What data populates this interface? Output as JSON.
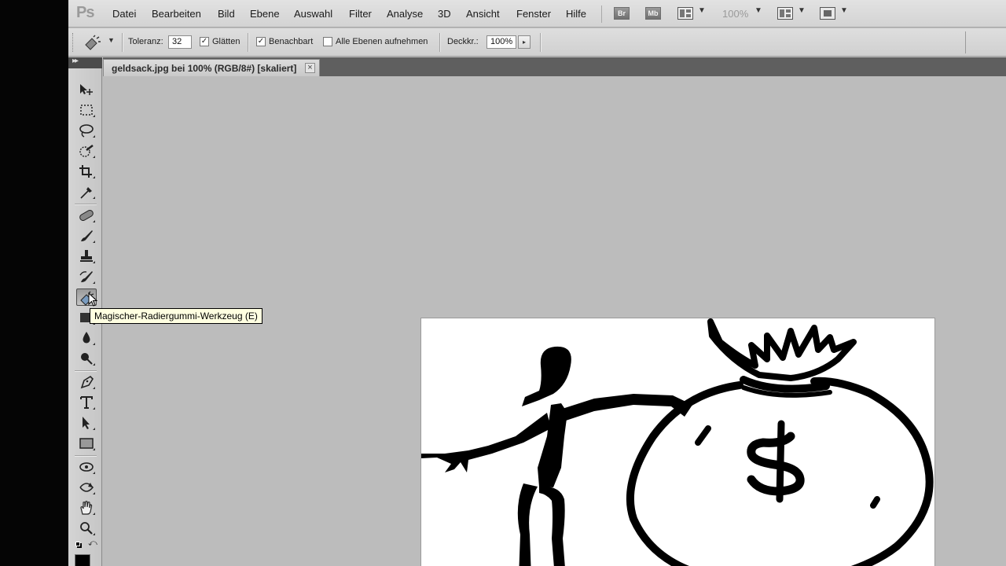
{
  "app": {
    "logo": "Ps",
    "menu": [
      "Datei",
      "Bearbeiten",
      "Bild",
      "Ebene",
      "Auswahl",
      "Filter",
      "Analyse",
      "3D",
      "Ansicht",
      "Fenster",
      "Hilfe"
    ],
    "bridge_label": "Br",
    "minibridge_label": "Mb",
    "zoom": "100%"
  },
  "options": {
    "tolerance_label": "Toleranz:",
    "tolerance_value": "32",
    "antialias_label": "Glätten",
    "antialias_checked": "✓",
    "contiguous_label": "Benachbart",
    "contiguous_checked": "✓",
    "all_layers_label": "Alle Ebenen aufnehmen",
    "opacity_label": "Deckkr.:",
    "opacity_value": "100%"
  },
  "document": {
    "tab_title": "geldsack.jpg bei 100% (RGB/8#) [skaliert]",
    "close_glyph": "×"
  },
  "tooltip": {
    "text": "Magischer-Radiergummi-Werkzeug (E)"
  },
  "tools": [
    {
      "name": "move-tool-icon"
    },
    {
      "name": "marquee-tool-icon"
    },
    {
      "name": "lasso-tool-icon"
    },
    {
      "name": "quick-selection-tool-icon"
    },
    {
      "name": "crop-tool-icon"
    },
    {
      "name": "eyedropper-tool-icon"
    },
    {
      "name": "healing-brush-tool-icon"
    },
    {
      "name": "brush-tool-icon"
    },
    {
      "name": "clone-stamp-tool-icon"
    },
    {
      "name": "history-brush-tool-icon"
    },
    {
      "name": "magic-eraser-tool-icon"
    },
    {
      "name": "gradient-tool-icon"
    },
    {
      "name": "blur-tool-icon"
    },
    {
      "name": "dodge-tool-icon"
    },
    {
      "name": "pen-tool-icon"
    },
    {
      "name": "type-tool-icon"
    },
    {
      "name": "path-selection-tool-icon"
    },
    {
      "name": "rectangle-tool-icon"
    },
    {
      "name": "3d-rotate-tool-icon"
    },
    {
      "name": "3d-orbit-tool-icon"
    },
    {
      "name": "hand-tool-icon"
    },
    {
      "name": "zoom-tool-icon"
    }
  ],
  "colors": {
    "foreground": "#000000",
    "background": "#ffffff",
    "workspace": "#bcbcbc"
  }
}
